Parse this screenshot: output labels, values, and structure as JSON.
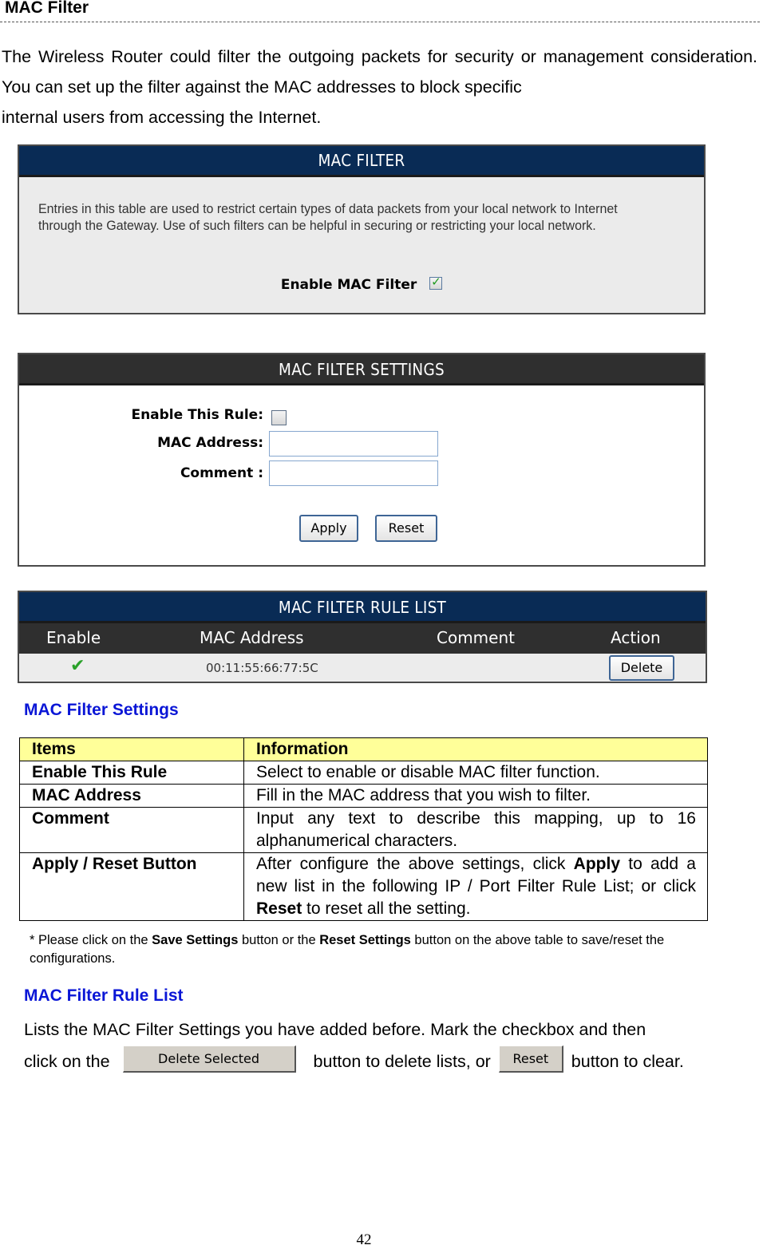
{
  "page": {
    "heading": "MAC Filter",
    "intro_lines": [
      "The Wireless Router could filter the outgoing packets for security or management consideration. You can set up the filter against the MAC addresses to block specific",
      "internal users from accessing the Internet."
    ],
    "page_number": "42"
  },
  "mac_filter_panel": {
    "title": "MAC FILTER",
    "description": "Entries in this table are used to restrict certain types of data packets from your local network to Internet through the Gateway. Use of such filters can be helpful in securing or restricting your local network.",
    "enable_label": "Enable MAC Filter",
    "enable_checked": true
  },
  "settings_panel": {
    "title": "MAC FILTER SETTINGS",
    "enable_rule_label": "Enable This Rule:",
    "enable_rule_checked": false,
    "mac_label": "MAC Address:",
    "mac_value": "",
    "comment_label": "Comment :",
    "comment_value": "",
    "apply_label": "Apply",
    "reset_label": "Reset"
  },
  "rule_list_panel": {
    "title": "MAC FILTER RULE LIST",
    "columns": [
      "Enable",
      "MAC Address",
      "Comment",
      "Action"
    ],
    "rows": [
      {
        "enabled_icon": "green-check-icon",
        "mac": "00:11:55:66:77:5C",
        "comment": "",
        "action_label": "Delete"
      }
    ]
  },
  "settings_section": {
    "title": "MAC Filter Settings",
    "table_headers": [
      "Items",
      "Information"
    ],
    "rows": [
      {
        "item": "Enable This Rule",
        "info": "Select to enable or disable MAC filter function."
      },
      {
        "item": "MAC Address",
        "info": "Fill in the MAC address that you wish to filter."
      },
      {
        "item": "Comment",
        "info": "Input any text to describe this mapping, up to 16 alphanumerical characters."
      },
      {
        "item": "Apply / Reset Button",
        "info_parts": [
          "After configure the above settings, click ",
          "Apply",
          " to add a new list in the following IP / Port Filter Rule List; or click ",
          "Reset",
          " to reset all the setting."
        ]
      }
    ],
    "note_parts": [
      "* Please click on the ",
      "Save Settings",
      " button or the ",
      "Reset Settings",
      " button on the above table to save/reset the configurations."
    ]
  },
  "rule_list_section": {
    "title": "MAC Filter Rule List",
    "text_1": "Lists the MAC Filter Settings you have added before. Mark the checkbox and then",
    "text_2a": "click on the",
    "delete_selected_label": "Delete Selected",
    "text_2b": "button to delete lists, or",
    "reset_label": "Reset",
    "text_2c": "button to clear."
  }
}
